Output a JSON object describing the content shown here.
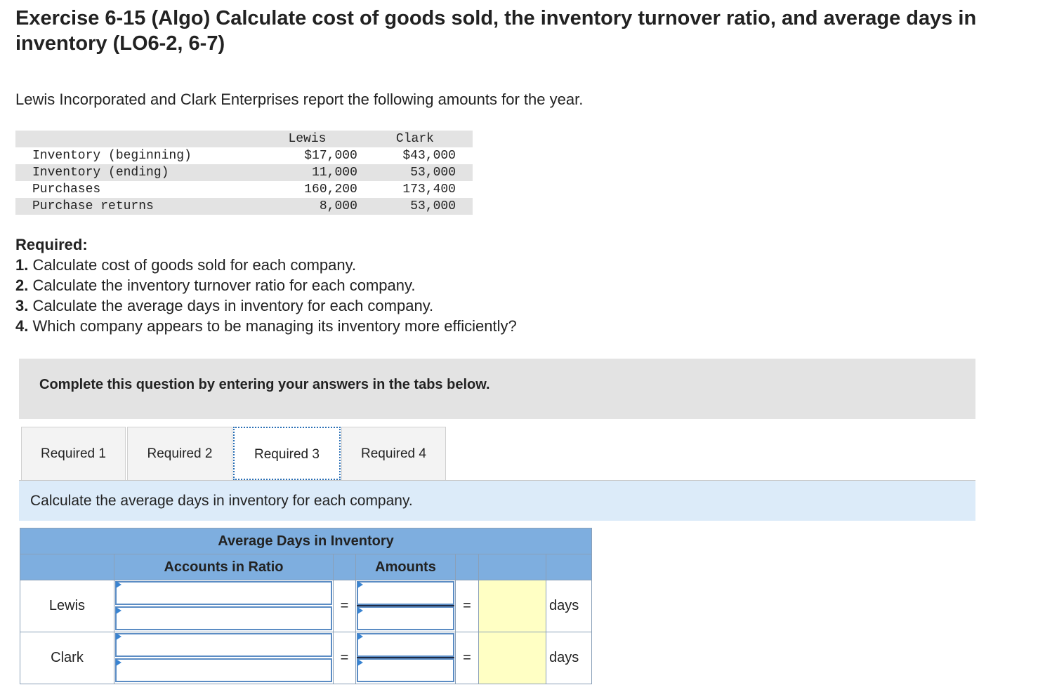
{
  "title": "Exercise 6-15 (Algo) Calculate cost of goods sold, the inventory turnover ratio, and average days in inventory (LO6-2, 6-7)",
  "intro": "Lewis Incorporated and Clark Enterprises report the following amounts for the year.",
  "data_table": {
    "headers": [
      "Lewis",
      "Clark"
    ],
    "rows": [
      {
        "label": "Inventory (beginning)",
        "lewis": "$17,000",
        "clark": "$43,000"
      },
      {
        "label": "Inventory (ending)",
        "lewis": "11,000",
        "clark": "53,000"
      },
      {
        "label": "Purchases",
        "lewis": "160,200",
        "clark": "173,400"
      },
      {
        "label": "Purchase returns",
        "lewis": "8,000",
        "clark": "53,000"
      }
    ]
  },
  "required": {
    "heading": "Required:",
    "items": [
      {
        "num": "1.",
        "text": "Calculate cost of goods sold for each company."
      },
      {
        "num": "2.",
        "text": "Calculate the inventory turnover ratio for each company."
      },
      {
        "num": "3.",
        "text": "Calculate the average days in inventory for each company."
      },
      {
        "num": "4.",
        "text": "Which company appears to be managing its inventory more efficiently?"
      }
    ]
  },
  "banner": "Complete this question by entering your answers in the tabs below.",
  "tabs": [
    {
      "label": "Required 1",
      "active": false
    },
    {
      "label": "Required 2",
      "active": false
    },
    {
      "label": "Required 3",
      "active": true
    },
    {
      "label": "Required 4",
      "active": false
    }
  ],
  "instruction": "Calculate the average days in inventory for each company.",
  "answer_grid": {
    "title": "Average Days in Inventory",
    "col_accounts": "Accounts in Ratio",
    "col_amounts": "Amounts",
    "eq": "=",
    "rows": [
      {
        "company": "Lewis",
        "unit": "days",
        "account_top": "",
        "account_bottom": "",
        "amount_top": "",
        "amount_bottom": "",
        "result": ""
      },
      {
        "company": "Clark",
        "unit": "days",
        "account_top": "",
        "account_bottom": "",
        "amount_top": "",
        "amount_bottom": "",
        "result": ""
      }
    ]
  }
}
